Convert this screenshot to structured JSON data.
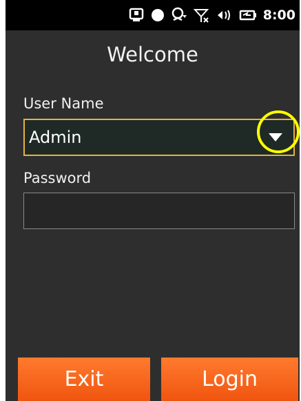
{
  "statusbar": {
    "time": "8:00",
    "icons": [
      "phone-icon",
      "record-icon",
      "sync-icon",
      "no-signal-icon",
      "volume-icon",
      "battery-icon"
    ]
  },
  "screen": {
    "title": "Welcome",
    "username_label": "User Name",
    "username_value": "Admin",
    "password_label": "Password",
    "password_value": ""
  },
  "buttons": {
    "exit": "Exit",
    "login": "Login"
  },
  "colors": {
    "background": "#2e2e2e",
    "accent_border": "#e6b23f",
    "button": "#f06418",
    "highlight_circle": "#ffff00"
  }
}
